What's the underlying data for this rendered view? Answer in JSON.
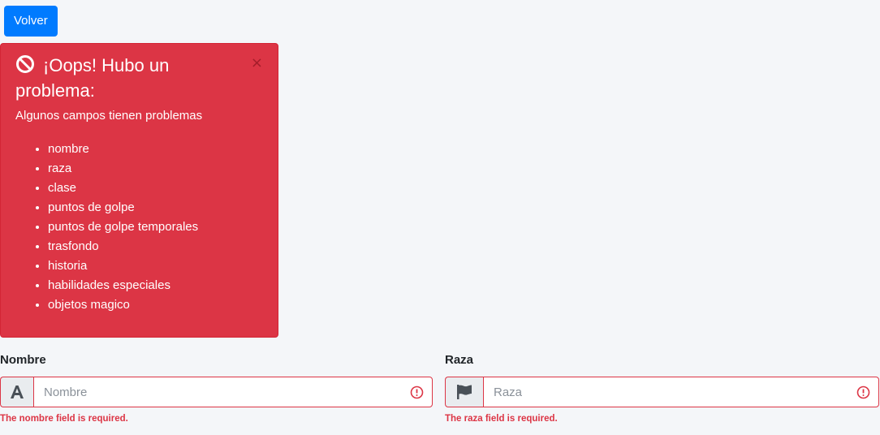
{
  "back_button": {
    "label": "Volver"
  },
  "alert": {
    "title": "¡Oops! Hubo un problema:",
    "close_symbol": "×",
    "message": "Algunos campos tienen problemas",
    "fields": [
      "nombre",
      "raza",
      "clase",
      "puntos de golpe",
      "puntos de golpe temporales",
      "trasfondo",
      "historia",
      "habilidades especiales",
      "objetos magico"
    ],
    "icon": "ban-icon"
  },
  "form": {
    "nombre": {
      "label": "Nombre",
      "placeholder": "Nombre",
      "value": "",
      "icon": "font-letter-a-icon",
      "error": "The nombre field is required."
    },
    "raza": {
      "label": "Raza",
      "placeholder": "Raza",
      "value": "",
      "icon": "flag-icon",
      "error": "The raza field is required."
    }
  },
  "colors": {
    "primary": "#007bff",
    "danger": "#dc3545",
    "background": "#f4f6f9"
  }
}
